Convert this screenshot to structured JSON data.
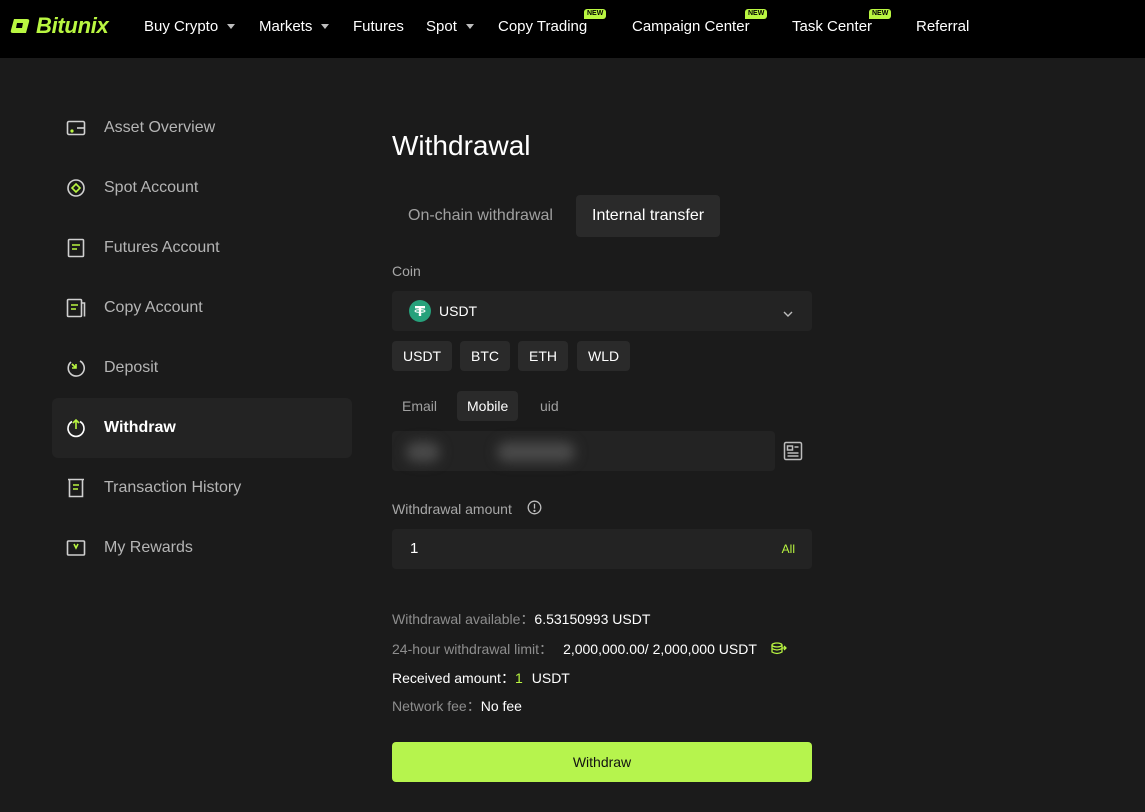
{
  "brand": {
    "name": "Bitunix",
    "color": "#b9f641"
  },
  "nav": {
    "items": [
      {
        "label": "Buy Crypto",
        "dropdown": true,
        "new": false
      },
      {
        "label": "Markets",
        "dropdown": true,
        "new": false
      },
      {
        "label": "Futures",
        "dropdown": false,
        "new": false
      },
      {
        "label": "Spot",
        "dropdown": true,
        "new": false
      },
      {
        "label": "Copy Trading",
        "dropdown": false,
        "new": true
      },
      {
        "label": "Campaign Center",
        "dropdown": false,
        "new": true
      },
      {
        "label": "Task Center",
        "dropdown": false,
        "new": true
      },
      {
        "label": "Referral",
        "dropdown": false,
        "new": false
      }
    ],
    "new_badge": "NEW"
  },
  "sidebar": {
    "items": [
      {
        "label": "Asset Overview",
        "icon": "wallet-icon",
        "active": false
      },
      {
        "label": "Spot Account",
        "icon": "spot-icon",
        "active": false
      },
      {
        "label": "Futures Account",
        "icon": "futures-icon",
        "active": false
      },
      {
        "label": "Copy Account",
        "icon": "copy-icon",
        "active": false
      },
      {
        "label": "Deposit",
        "icon": "deposit-icon",
        "active": false
      },
      {
        "label": "Withdraw",
        "icon": "withdraw-icon",
        "active": true
      },
      {
        "label": "Transaction History",
        "icon": "receipt-icon",
        "active": false
      },
      {
        "label": "My Rewards",
        "icon": "rewards-icon",
        "active": false
      }
    ]
  },
  "main": {
    "title": "Withdrawal",
    "tabs": [
      {
        "label": "On-chain withdrawal",
        "active": false
      },
      {
        "label": "Internal transfer",
        "active": true
      }
    ],
    "coin": {
      "label": "Coin",
      "selected": "USDT",
      "quick_coins": [
        "USDT",
        "BTC",
        "ETH",
        "WLD"
      ]
    },
    "recipient": {
      "tabs": [
        {
          "label": "Email",
          "active": false
        },
        {
          "label": "Mobile",
          "active": true
        },
        {
          "label": "uid",
          "active": false
        }
      ]
    },
    "amount": {
      "label": "Withdrawal amount",
      "value": "1",
      "all_label": "All"
    },
    "summary": {
      "available_label": "Withdrawal available：",
      "available_value": "6.53150993 USDT",
      "limit_label": "24-hour withdrawal limit：",
      "limit_value": "2,000,000.00/ 2,000,000 USDT",
      "received_label": "Received amount：",
      "received_value": "1",
      "received_unit": "USDT",
      "fee_label": "Network fee：",
      "fee_value": "No fee"
    },
    "submit_label": "Withdraw"
  },
  "colors": {
    "accent": "#b9f641",
    "background": "#1b1b1b",
    "topbar": "#000000",
    "tether": "#26a17b"
  }
}
